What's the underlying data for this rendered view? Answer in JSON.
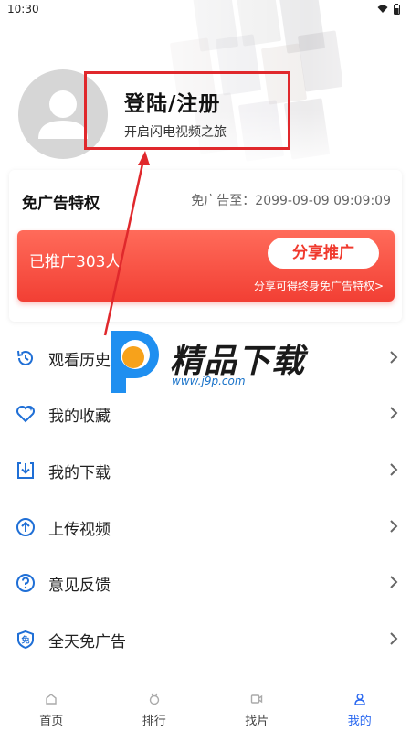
{
  "status": {
    "time": "10:30"
  },
  "profile": {
    "title": "登陆/注册",
    "subtitle": "开启闪电视频之旅"
  },
  "vip": {
    "title": "免广告特权",
    "expire": "免广告至：2099-09-09 09:09:09",
    "promo_count": "已推广303人",
    "share_label": "分享推广",
    "share_sub": "分享可得终身免广告特权>"
  },
  "menu": [
    {
      "label": "观看历史",
      "icon": "history-icon"
    },
    {
      "label": "我的收藏",
      "icon": "heart-icon"
    },
    {
      "label": "我的下载",
      "icon": "download-icon"
    },
    {
      "label": "上传视频",
      "icon": "upload-icon"
    },
    {
      "label": "意见反馈",
      "icon": "question-icon"
    },
    {
      "label": "全天免广告",
      "icon": "no-ad-icon"
    }
  ],
  "watermark": {
    "title": "精品下载",
    "url": "www.j9p.com"
  },
  "tabs": [
    {
      "label": "首页",
      "icon": "home-icon"
    },
    {
      "label": "排行",
      "icon": "rank-icon"
    },
    {
      "label": "找片",
      "icon": "video-icon"
    },
    {
      "label": "我的",
      "icon": "user-icon"
    }
  ],
  "colors": {
    "accent": "#2a68f0",
    "promo": "#f23f34",
    "highlight": "#e0282c",
    "icon": "#1f6fd6"
  }
}
